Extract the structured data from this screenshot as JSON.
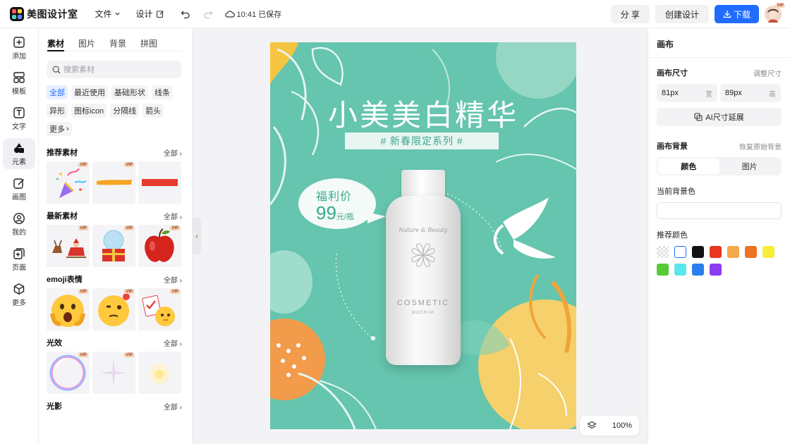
{
  "app": {
    "name": "美图设计室"
  },
  "menu": {
    "file": "文件",
    "design": "设计",
    "saved_status": "10:41 已保存"
  },
  "top_actions": {
    "share": "分 享",
    "create": "创建设计",
    "download": "下载",
    "avatar_badge": "VIP"
  },
  "left_rail": [
    {
      "label": "添加",
      "icon": "plus-square-icon"
    },
    {
      "label": "模板",
      "icon": "template-grid-icon"
    },
    {
      "label": "文字",
      "icon": "text-icon"
    },
    {
      "label": "元素",
      "icon": "shapes-icon"
    },
    {
      "label": "画图",
      "icon": "draw-icon"
    },
    {
      "label": "我的",
      "icon": "user-icon"
    },
    {
      "label": "页面",
      "icon": "page-icon"
    },
    {
      "label": "更多",
      "icon": "cube-icon"
    }
  ],
  "assets": {
    "tabs": [
      "素材",
      "图片",
      "背景",
      "拼图"
    ],
    "search_placeholder": "搜索素材",
    "chips": [
      "全部",
      "最近使用",
      "基础形状",
      "线条",
      "异形",
      "图标icon",
      "分隔线",
      "箭头",
      "更多"
    ],
    "sections": [
      {
        "title": "推荐素材",
        "all": "全部"
      },
      {
        "title": "最新素材",
        "all": "全部"
      },
      {
        "title": "emoji表情",
        "all": "全部"
      },
      {
        "title": "光效",
        "all": "全部"
      },
      {
        "title": "光影",
        "all": "全部"
      }
    ],
    "vip": "VIP"
  },
  "poster": {
    "title": "小美美白精华",
    "subtitle": "# 新春限定系列 #",
    "price_label": "福利价",
    "price": "99",
    "price_unit": "元/瓶",
    "bottle_script": "Nature & Beauty",
    "bottle_brand": "COSMETIC",
    "bottle_sub": "MOCKUP"
  },
  "zoom": "100%",
  "right_panel": {
    "title": "画布",
    "size_label": "画布尺寸",
    "size_adjust": "调整尺寸",
    "width_value": "81px",
    "width_unit": "宽",
    "height_value": "89px",
    "height_unit": "高",
    "ai_extend": "AI尺寸延展",
    "bg_label": "画布背景",
    "bg_reset": "恢复原始背景",
    "bg_tab_color": "颜色",
    "bg_tab_image": "图片",
    "current_bg": "当前背景色",
    "recommend": "推荐颜色",
    "colors": [
      "#ffffff",
      "#111111",
      "#e8361f",
      "#f3a94a",
      "#ee7224",
      "#f6ee3b",
      "#55cc35",
      "#5be7f0",
      "#2a7fee",
      "#8a3cf0"
    ]
  }
}
